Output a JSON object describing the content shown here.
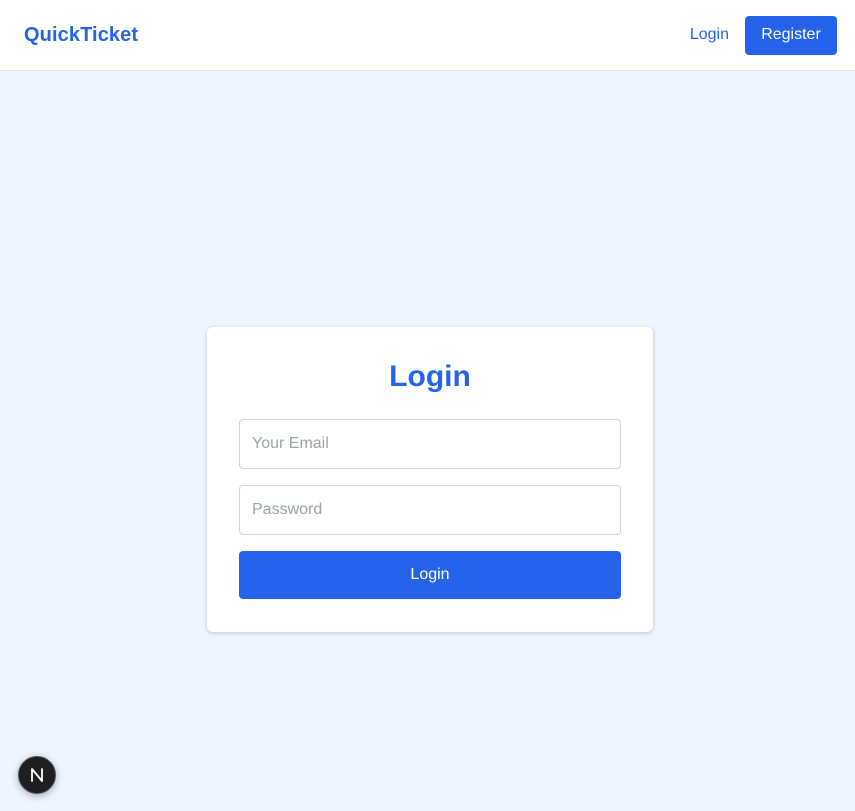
{
  "navbar": {
    "brand": "QuickTicket",
    "login_link": "Login",
    "register_button": "Register"
  },
  "login_card": {
    "title": "Login",
    "email_placeholder": "Your Email",
    "password_placeholder": "Password",
    "submit_label": "Login"
  },
  "devtools": {
    "icon": "nextjs-logo-icon",
    "letter": "N"
  },
  "colors": {
    "primary": "#2563eb",
    "page_background": "#eef5fe",
    "card_background": "#ffffff"
  }
}
